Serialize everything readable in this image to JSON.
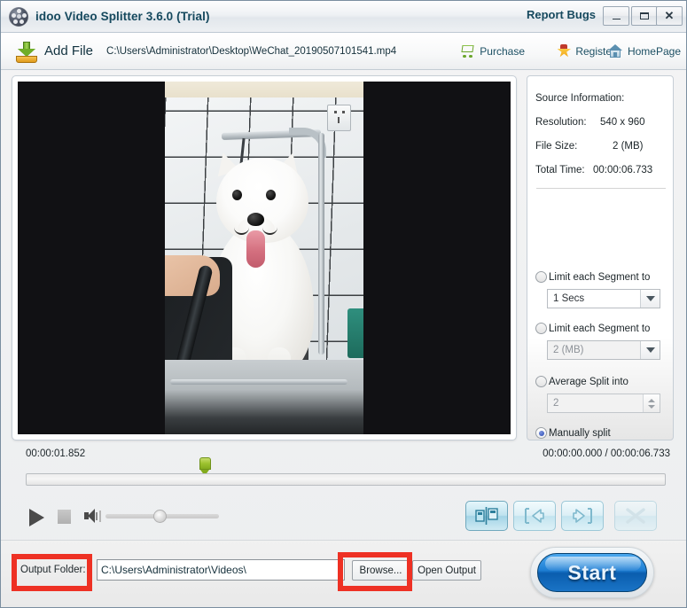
{
  "window": {
    "title": "idoo Video Splitter 3.6.0 (Trial)",
    "report_bugs": "Report Bugs",
    "minimize": "–",
    "maximize": "❐",
    "close": "✕"
  },
  "toolbar": {
    "add_file": "Add File",
    "file_path": "C:\\Users\\Administrator\\Desktop\\WeChat_20190507101541.mp4",
    "purchase": "Purchase",
    "register": "Register",
    "homepage": "HomePage"
  },
  "source_info": {
    "heading": "Source Information:",
    "resolution_label": "Resolution:",
    "resolution_value": "540 x 960",
    "filesize_label": "File Size:",
    "filesize_value": "2 (MB)",
    "totaltime_label": "Total Time:",
    "totaltime_value": "00:00:06.733"
  },
  "split_options": [
    {
      "label": "Limit each Segment to",
      "selected": false,
      "value": "1 Secs",
      "control": "combo",
      "enabled": true
    },
    {
      "label": "Limit each Segment to",
      "selected": false,
      "value": "2 (MB)",
      "control": "combo",
      "enabled": false
    },
    {
      "label": "Average Split into",
      "selected": false,
      "value": "2",
      "control": "spinner",
      "enabled": false
    },
    {
      "label": "Manually split",
      "selected": true,
      "value": "",
      "control": "none",
      "enabled": true
    }
  ],
  "timeline": {
    "marker_time": "00:00:01.852",
    "position_total": "00:00:00.000 / 00:00:06.733",
    "marker_percent": 27
  },
  "controls": {
    "play": "play-button",
    "stop": "stop-button",
    "volume": "volume-icon",
    "volume_percent": 42,
    "segment_split": "split-segment-button",
    "segment_prev": "previous-segment-button",
    "segment_next": "next-segment-button",
    "segment_delete": "delete-segment-button"
  },
  "output": {
    "label": "Output Folder:",
    "path": "C:\\Users\\Administrator\\Videos\\",
    "browse": "Browse...",
    "open_output": "Open Output",
    "start": "Start"
  },
  "colors": {
    "title_text": "#16495e",
    "accent_blue": "#1f7fd4",
    "highlight_red": "#ee3124",
    "marker_green": "#9cc22e"
  }
}
